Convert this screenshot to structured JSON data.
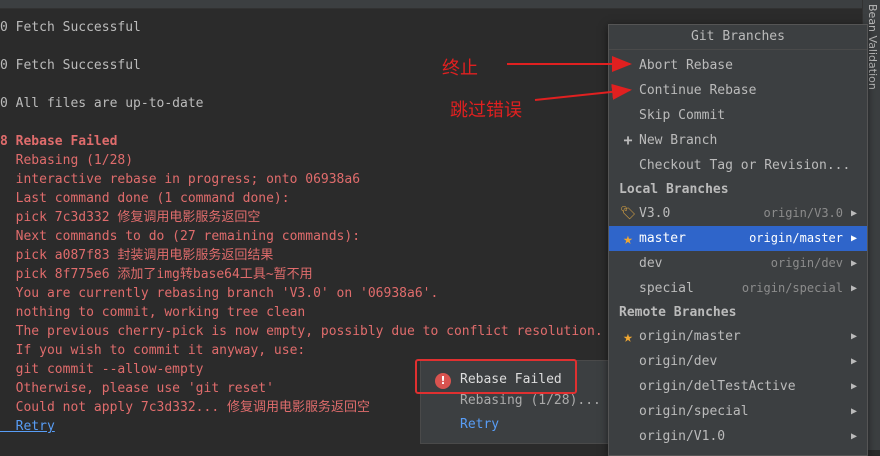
{
  "log_lines": [
    {
      "text": "0 Fetch Successful",
      "kind": "ok"
    },
    {
      "text": "0 Fetch Successful",
      "kind": "ok"
    },
    {
      "text": "0 All files are up-to-date",
      "kind": "ok"
    },
    {
      "text": "8 Rebase Failed",
      "kind": "errb"
    },
    {
      "text": "  Rebasing (1/28)",
      "kind": "err"
    },
    {
      "text": "  interactive rebase in progress; onto 06938a6",
      "kind": "err"
    },
    {
      "text": "  Last command done (1 command done):",
      "kind": "err"
    },
    {
      "text": "  pick 7c3d332 修复调用电影服务返回空",
      "kind": "err"
    },
    {
      "text": "  Next commands to do (27 remaining commands):",
      "kind": "err"
    },
    {
      "text": "  pick a087f83 封装调用电影服务返回结果",
      "kind": "err"
    },
    {
      "text": "  pick 8f775e6 添加了img转base64工具~暂不用",
      "kind": "err"
    },
    {
      "text": "  You are currently rebasing branch 'V3.0' on '06938a6'.",
      "kind": "err"
    },
    {
      "text": "  nothing to commit, working tree clean",
      "kind": "err"
    },
    {
      "text": "  The previous cherry-pick is now empty, possibly due to conflict resolution.",
      "kind": "err"
    },
    {
      "text": "  If you wish to commit it anyway, use:",
      "kind": "err"
    },
    {
      "text": "  git commit --allow-empty",
      "kind": "err"
    },
    {
      "text": "  Otherwise, please use 'git reset'",
      "kind": "err"
    },
    {
      "text": "  Could not apply 7c3d332... 修复调用电影服务返回空",
      "kind": "err"
    },
    {
      "text": "  Retry",
      "kind": "link"
    }
  ],
  "side_panel_label": "Bean Validation",
  "git_branches": {
    "title": "Git Branches",
    "actions": [
      "Abort Rebase",
      "Continue Rebase",
      "Skip Commit",
      "New Branch",
      "Checkout Tag or Revision..."
    ],
    "local_header": "Local Branches",
    "local": [
      {
        "name": "V3.0",
        "remote": "origin/V3.0",
        "icon": "tag-icon",
        "selected": false
      },
      {
        "name": "master",
        "remote": "origin/master",
        "icon": "star-icon",
        "selected": true
      },
      {
        "name": "dev",
        "remote": "origin/dev",
        "icon": "",
        "selected": false
      },
      {
        "name": "special",
        "remote": "origin/special",
        "icon": "",
        "selected": false
      }
    ],
    "remote_header": "Remote Branches",
    "remote": [
      {
        "name": "origin/master",
        "icon": "star-icon"
      },
      {
        "name": "origin/dev",
        "icon": ""
      },
      {
        "name": "origin/delTestActive",
        "icon": ""
      },
      {
        "name": "origin/special",
        "icon": ""
      },
      {
        "name": "origin/V1.0",
        "icon": ""
      }
    ]
  },
  "notification": {
    "title": "Rebase Failed",
    "subtitle": "Rebasing (1/28)...",
    "action": "Retry"
  },
  "annotations": {
    "abort": "终止",
    "skip": "跳过错误"
  },
  "colors": {
    "error_text": "#e06c6c",
    "link": "#589df6",
    "selection": "#2f65ca",
    "annotation": "#e02020"
  }
}
